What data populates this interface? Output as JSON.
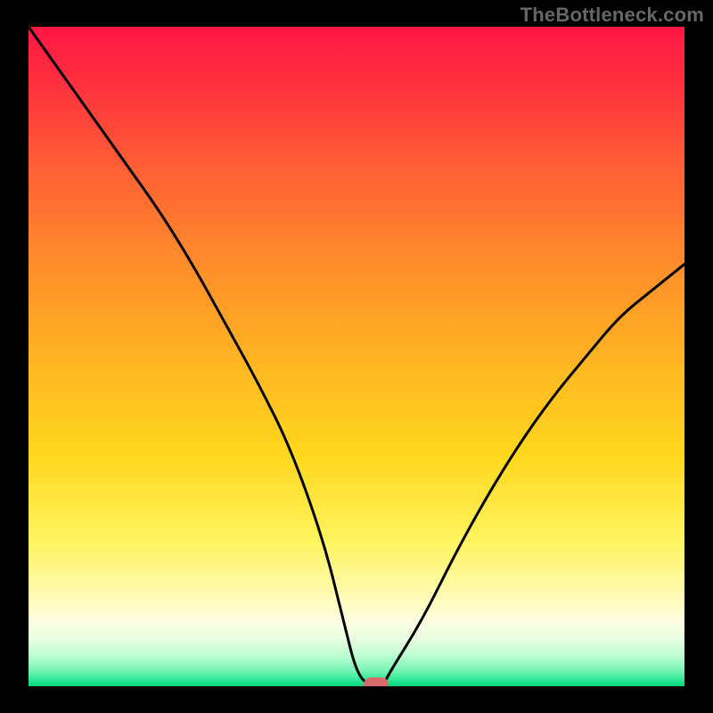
{
  "watermark": "TheBottleneck.com",
  "chart_data": {
    "type": "line",
    "title": "",
    "xlabel": "",
    "ylabel": "",
    "xlim": [
      0,
      100
    ],
    "ylim": [
      0,
      100
    ],
    "x": [
      0,
      5,
      10,
      15,
      20,
      25,
      30,
      35,
      40,
      45,
      48,
      50,
      52,
      54,
      55,
      60,
      65,
      70,
      75,
      80,
      85,
      90,
      95,
      100
    ],
    "values": [
      100,
      93,
      86,
      79,
      72,
      64,
      55,
      46,
      36,
      22,
      10,
      2,
      0,
      0,
      2,
      10,
      20,
      29,
      37,
      44,
      50,
      56,
      60,
      64
    ],
    "marker": {
      "x": 53,
      "y": 0
    },
    "background_gradient_stops": [
      {
        "offset": 0.0,
        "color": "#ff1744"
      },
      {
        "offset": 0.08,
        "color": "#ff2e3f"
      },
      {
        "offset": 0.2,
        "color": "#ff5a36"
      },
      {
        "offset": 0.35,
        "color": "#ff8a2b"
      },
      {
        "offset": 0.5,
        "color": "#ffb323"
      },
      {
        "offset": 0.65,
        "color": "#ffd81e"
      },
      {
        "offset": 0.78,
        "color": "#fff45f"
      },
      {
        "offset": 0.86,
        "color": "#fffbb0"
      },
      {
        "offset": 0.9,
        "color": "#fffde0"
      },
      {
        "offset": 0.93,
        "color": "#e7ffdf"
      },
      {
        "offset": 0.955,
        "color": "#b8fccf"
      },
      {
        "offset": 0.975,
        "color": "#7af6b4"
      },
      {
        "offset": 0.99,
        "color": "#2fe997"
      },
      {
        "offset": 1.0,
        "color": "#06d67e"
      }
    ],
    "line_color": "#000000",
    "line_width": 3,
    "marker_style": {
      "fill": "#d86a6a",
      "rx": 8,
      "ry": 8,
      "width": 28,
      "height": 16
    }
  }
}
